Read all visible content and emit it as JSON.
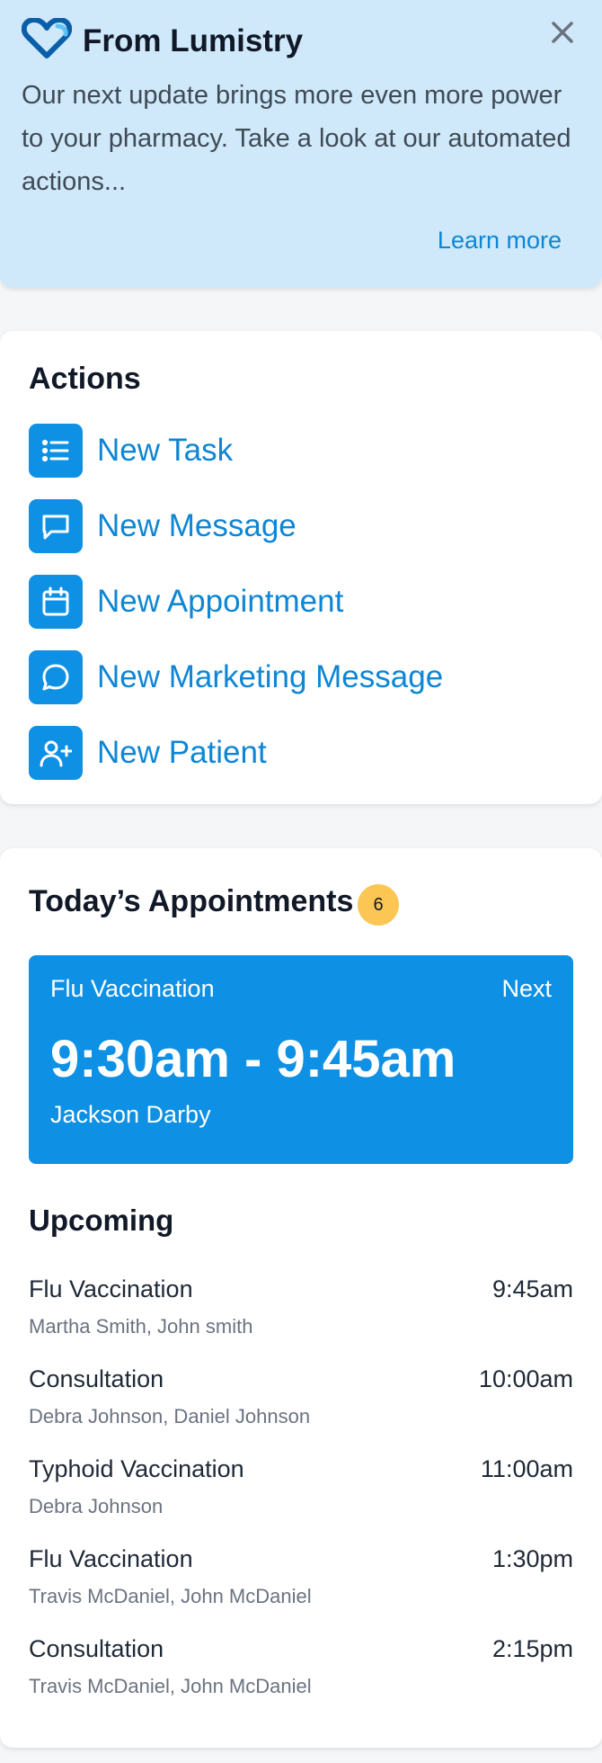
{
  "banner": {
    "title": "From Lumistry",
    "body": "Our next update brings more even more power to your pharmacy. Take a look at our automated actions...",
    "link": "Learn more",
    "logo_icon": "heart-logo-icon",
    "close_icon": "close-icon",
    "background": "#cfe9fb"
  },
  "actions": {
    "title": "Actions",
    "items": [
      {
        "label": "New Task",
        "icon": "list-icon"
      },
      {
        "label": "New Message",
        "icon": "message-square-icon"
      },
      {
        "label": "New Appointment",
        "icon": "calendar-icon"
      },
      {
        "label": "New Marketing Message",
        "icon": "chat-bubble-icon"
      },
      {
        "label": "New Patient",
        "icon": "add-user-icon"
      }
    ]
  },
  "appointments": {
    "title": "Today’s Appointments",
    "count": "6",
    "next": {
      "type": "Flu Vaccination",
      "tag": "Next",
      "time": "9:30am - 9:45am",
      "patient": "Jackson Darby"
    },
    "upcoming_title": "Upcoming",
    "upcoming": [
      {
        "type": "Flu Vaccination",
        "time": "9:45am",
        "people": "Martha Smith, John smith"
      },
      {
        "type": "Consultation",
        "time": "10:00am",
        "people": "Debra Johnson, Daniel Johnson"
      },
      {
        "type": "Typhoid Vaccination",
        "time": "11:00am",
        "people": "Debra Johnson"
      },
      {
        "type": "Flu Vaccination",
        "time": "1:30pm",
        "people": "Travis McDaniel, John McDaniel"
      },
      {
        "type": "Consultation",
        "time": "2:15pm",
        "people": "Travis McDaniel, John McDaniel"
      }
    ]
  },
  "colors": {
    "accent": "#0e90e4",
    "link": "#0e86d4",
    "badge": "#fbc653"
  }
}
